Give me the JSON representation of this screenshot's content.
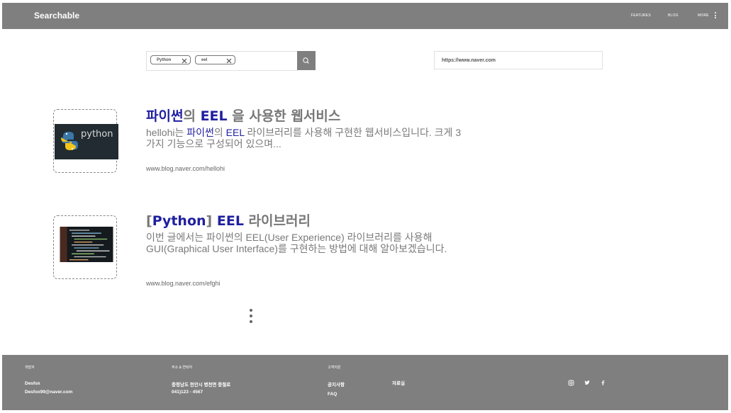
{
  "header": {
    "brand": "Searchable",
    "nav": [
      "FEATURES",
      "BLOG",
      "MORE"
    ]
  },
  "search": {
    "tags": [
      "Python",
      "eel"
    ],
    "url_value": "https://www.naver.com"
  },
  "results": [
    {
      "title_parts": [
        {
          "text": "파이썬",
          "hl": true
        },
        {
          "text": "의 ",
          "hl": false
        },
        {
          "text": "EEL",
          "hl": true
        },
        {
          "text": " 을 사용한 웹서비스",
          "hl": false
        }
      ],
      "desc_parts": [
        {
          "text": "hellohi는 ",
          "hl": false
        },
        {
          "text": "파이썬",
          "hl": true
        },
        {
          "text": "의 ",
          "hl": false
        },
        {
          "text": "EEL",
          "hl": true
        },
        {
          "text": " 라이브러리를 사용해 구현한 웹서비스입니다. 크게 3가지 기능으로 구성되어 있으며...",
          "hl": false
        }
      ],
      "url": "www.blog.naver.com/hellohi",
      "thumb_text": "python"
    },
    {
      "title_parts": [
        {
          "text": "[",
          "hl": false
        },
        {
          "text": "Python",
          "hl": true
        },
        {
          "text": "] ",
          "hl": false
        },
        {
          "text": "EEL",
          "hl": true
        },
        {
          "text": " 라이브러리",
          "hl": false
        }
      ],
      "desc_parts": [
        {
          "text": "이번 글에서는 파이썬의 EEL(User Experience) 라이브러리를 사용해  GUI(Graphical User Interface)를 구현하는 방법에 대해 알아보겠습니다.",
          "hl": false
        }
      ],
      "url": "www.blog.naver.com/efghi",
      "thumb_text": ""
    }
  ],
  "footer": {
    "developer_label": "개발자",
    "developer_name": "Desfox",
    "developer_email": "Desfox99@naver.com",
    "address_label": "주소 & 연락처",
    "address": "충청남도 천안시 병천면 충절로",
    "phone": "041)123 - 4567",
    "support_label": "고객지원",
    "notice": "공지사항",
    "faq": "FAQ",
    "resources": "자료실",
    "social_icons": [
      "instagram-icon",
      "twitter-icon",
      "facebook-icon"
    ]
  },
  "colors": {
    "bar": "#7f7f7f",
    "highlight": "#1f1fa0",
    "text_gray": "#7a7a7a"
  }
}
